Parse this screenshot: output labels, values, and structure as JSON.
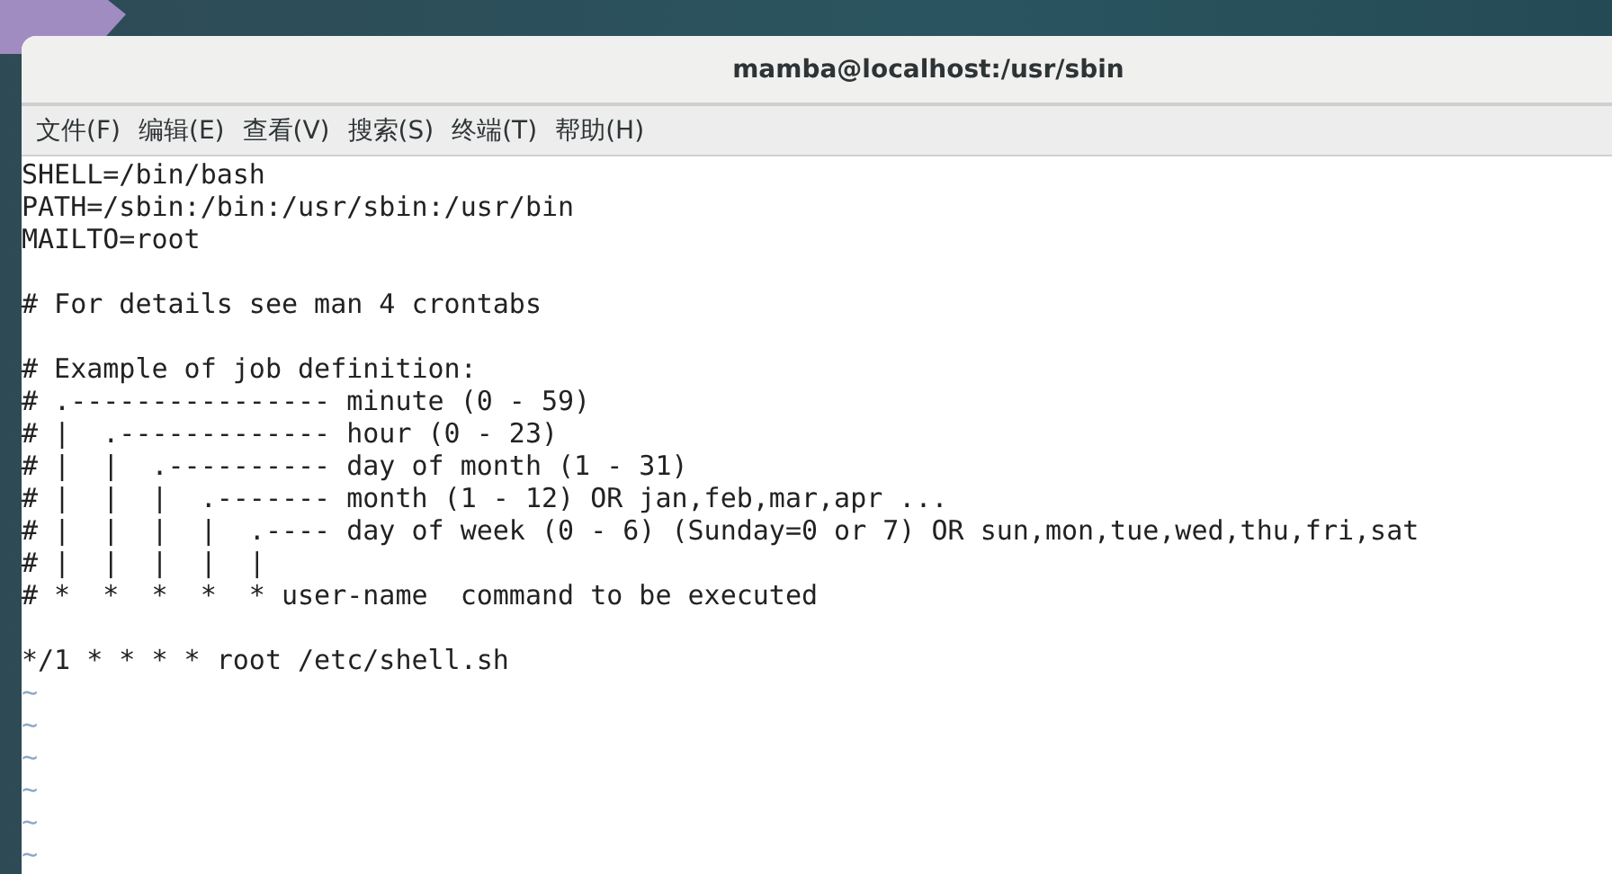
{
  "window": {
    "title": "mamba@localhost:/usr/sbin"
  },
  "menu": [
    "文件(F)",
    "编辑(E)",
    "查看(V)",
    "搜索(S)",
    "终端(T)",
    "帮助(H)"
  ],
  "lines": [
    {
      "kind": "text",
      "text": "SHELL=/bin/bash"
    },
    {
      "kind": "text",
      "text": "PATH=/sbin:/bin:/usr/sbin:/usr/bin"
    },
    {
      "kind": "text",
      "text": "MAILTO=root"
    },
    {
      "kind": "blank"
    },
    {
      "kind": "text",
      "text": "# For details see man 4 crontabs"
    },
    {
      "kind": "blank"
    },
    {
      "kind": "text",
      "text": "# Example of job definition:"
    },
    {
      "kind": "text",
      "text": "# .---------------- minute (0 - 59)"
    },
    {
      "kind": "text",
      "text": "# |  .------------- hour (0 - 23)"
    },
    {
      "kind": "text",
      "text": "# |  |  .---------- day of month (1 - 31)"
    },
    {
      "kind": "text",
      "text": "# |  |  |  .------- month (1 - 12) OR jan,feb,mar,apr ..."
    },
    {
      "kind": "text",
      "text": "# |  |  |  |  .---- day of week (0 - 6) (Sunday=0 or 7) OR sun,mon,tue,wed,thu,fri,sat"
    },
    {
      "kind": "text",
      "text": "# |  |  |  |  |"
    },
    {
      "kind": "text",
      "text": "# *  *  *  *  * user-name  command to be executed"
    },
    {
      "kind": "blank"
    },
    {
      "kind": "text",
      "text": "*/1 * * * * root /etc/shell.sh"
    },
    {
      "kind": "tilde",
      "text": "~"
    },
    {
      "kind": "tilde",
      "text": "~"
    },
    {
      "kind": "tilde",
      "text": "~"
    },
    {
      "kind": "tilde",
      "text": "~"
    },
    {
      "kind": "tilde",
      "text": "~"
    },
    {
      "kind": "tilde",
      "text": "~"
    }
  ]
}
